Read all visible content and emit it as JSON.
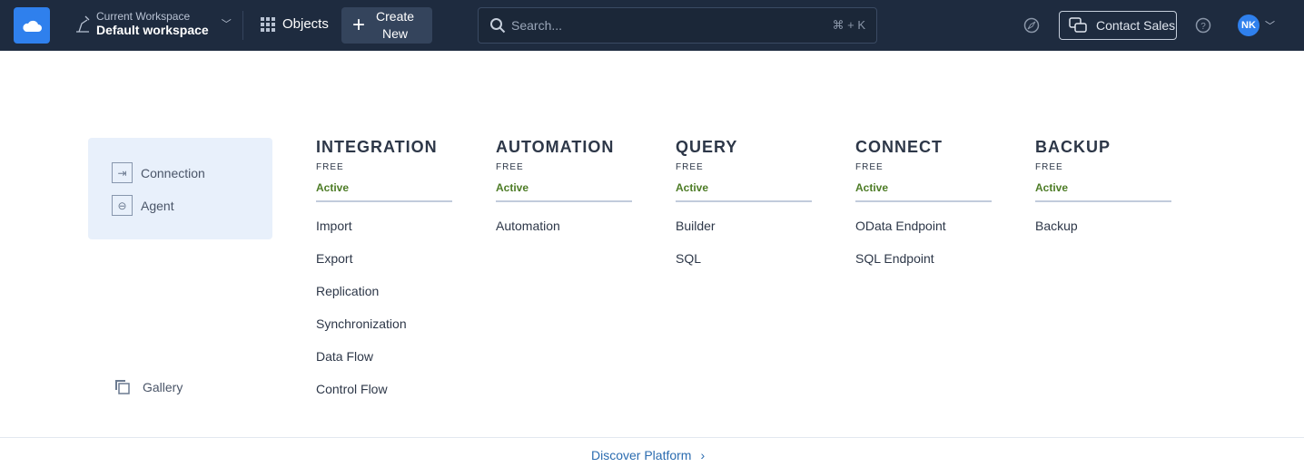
{
  "header": {
    "workspace_label": "Current Workspace",
    "workspace_name": "Default workspace",
    "objects": "Objects",
    "create_new_line1": "Create",
    "create_new_line2": "New",
    "search_placeholder": "Search...",
    "search_shortcut": "⌘ + K",
    "contact_sales": "Contact Sales",
    "avatar_initials": "NK"
  },
  "sidebar": {
    "items": [
      {
        "label": "Connection"
      },
      {
        "label": "Agent"
      }
    ],
    "gallery": "Gallery"
  },
  "products": [
    {
      "title": "INTEGRATION",
      "plan": "FREE",
      "status": "Active",
      "items": [
        "Import",
        "Export",
        "Replication",
        "Synchronization",
        "Data Flow",
        "Control Flow"
      ]
    },
    {
      "title": "AUTOMATION",
      "plan": "FREE",
      "status": "Active",
      "items": [
        "Automation"
      ]
    },
    {
      "title": "QUERY",
      "plan": "FREE",
      "status": "Active",
      "items": [
        "Builder",
        "SQL"
      ]
    },
    {
      "title": "CONNECT",
      "plan": "FREE",
      "status": "Active",
      "items": [
        "OData Endpoint",
        "SQL Endpoint"
      ]
    },
    {
      "title": "BACKUP",
      "plan": "FREE",
      "status": "Active",
      "items": [
        "Backup"
      ]
    }
  ],
  "footer": {
    "discover": "Discover Platform"
  },
  "colors": {
    "header_bg": "#1e2b3f",
    "accent": "#2f80ed",
    "active": "#4d7c26"
  }
}
